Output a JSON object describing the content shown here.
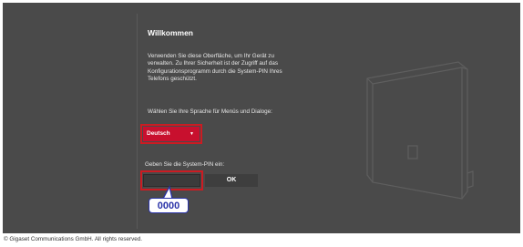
{
  "welcome": {
    "title": "Willkommen",
    "intro": "Verwenden Sie diese Oberfläche, um Ihr Gerät zu verwalten. Zu Ihrer Sicherheit ist der Zugriff auf das Konfigurationsprogramm durch die System-PIN Ihres Telefons geschützt."
  },
  "language": {
    "prompt": "Wählen Sie Ihre Sprache für Menüs und Dialoge:",
    "selected": "Deutsch",
    "caret_icon": "caret-down-icon"
  },
  "pin": {
    "prompt": "Geben Sie die System-PIN ein:",
    "value": "",
    "ok_label": "OK",
    "callout": "0000"
  },
  "footer": {
    "copyright": "© Gigaset Communications GmbH. All rights reserved."
  },
  "colors": {
    "background": "#4a4a4a",
    "accent": "#c8102e",
    "highlight": "#cc1b22",
    "callout": "#2a33a8"
  }
}
